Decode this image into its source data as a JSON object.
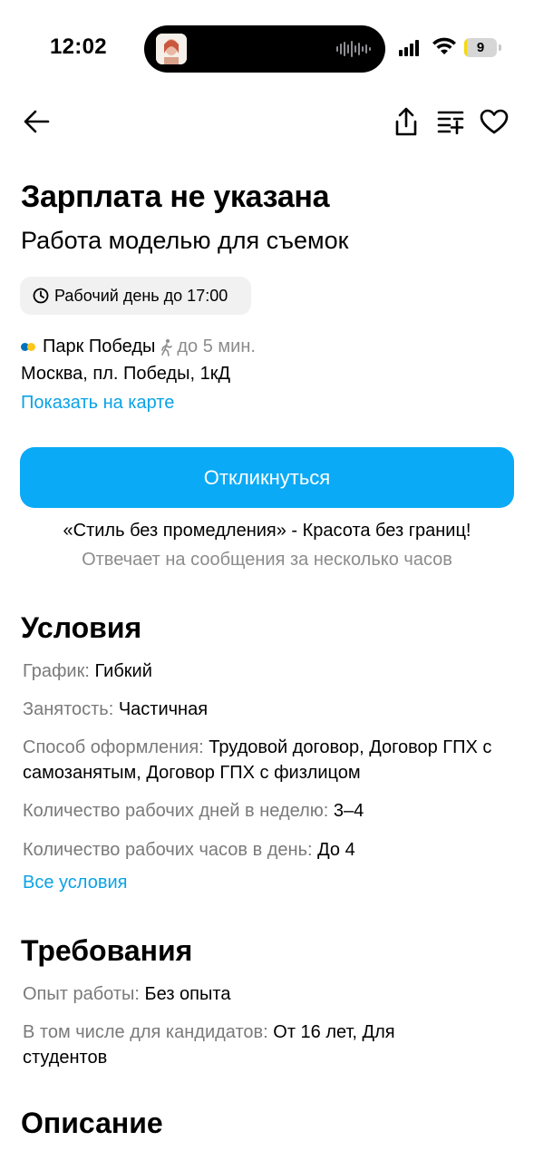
{
  "status_bar": {
    "time": "12:02",
    "battery": "9",
    "battery_percent": 9,
    "icons": [
      "signal-icon",
      "wifi-icon",
      "battery-icon"
    ]
  },
  "nav": {
    "icons": [
      "arrow-left-icon",
      "share-icon",
      "compare-icon",
      "heart-icon"
    ]
  },
  "vacancy": {
    "salary": "Зарплата не указана",
    "title": "Работа моделью для съемок",
    "schedule_chip": "Рабочий день до 17:00",
    "metro_station": "Парк Победы",
    "metro_colors": [
      "#0072ba",
      "#ffc61a"
    ],
    "walk_time": "до 5 мин.",
    "address": "Москва, пл. Победы, 1кД",
    "map_link": "Показать на карте",
    "respond_button": "Откликнуться",
    "employer": "«Стиль без промедления» - Красота без границ!",
    "reply_time": "Отвечает на сообщения за несколько часов"
  },
  "conditions": {
    "title": "Условия",
    "schedule_label": "График: ",
    "schedule_value": "Гибкий",
    "employment_label": "Занятость: ",
    "employment_value": "Частичная",
    "contract_label": "Способ оформления: ",
    "contract_value": "Трудовой договор, Договор ГПХ с самозанятым, Договор ГПХ с физлицом",
    "days_label": "Количество рабочих дней в неделю: ",
    "days_value": "3–4",
    "hours_label": "Количество рабочих часов в день: ",
    "hours_value": "До 4",
    "all_link": "Все условия"
  },
  "requirements": {
    "title": "Требования",
    "experience_label": "Опыт работы: ",
    "experience_value": "Без опыта",
    "candidates_label": "В том числе для кандидатов: ",
    "candidates_value": "От 16 лет, Для студентов"
  },
  "description": {
    "title": "Описание"
  },
  "colors": {
    "accent": "#0aaaf6",
    "link": "#0ba2e6",
    "muted": "#8c8c8c"
  }
}
